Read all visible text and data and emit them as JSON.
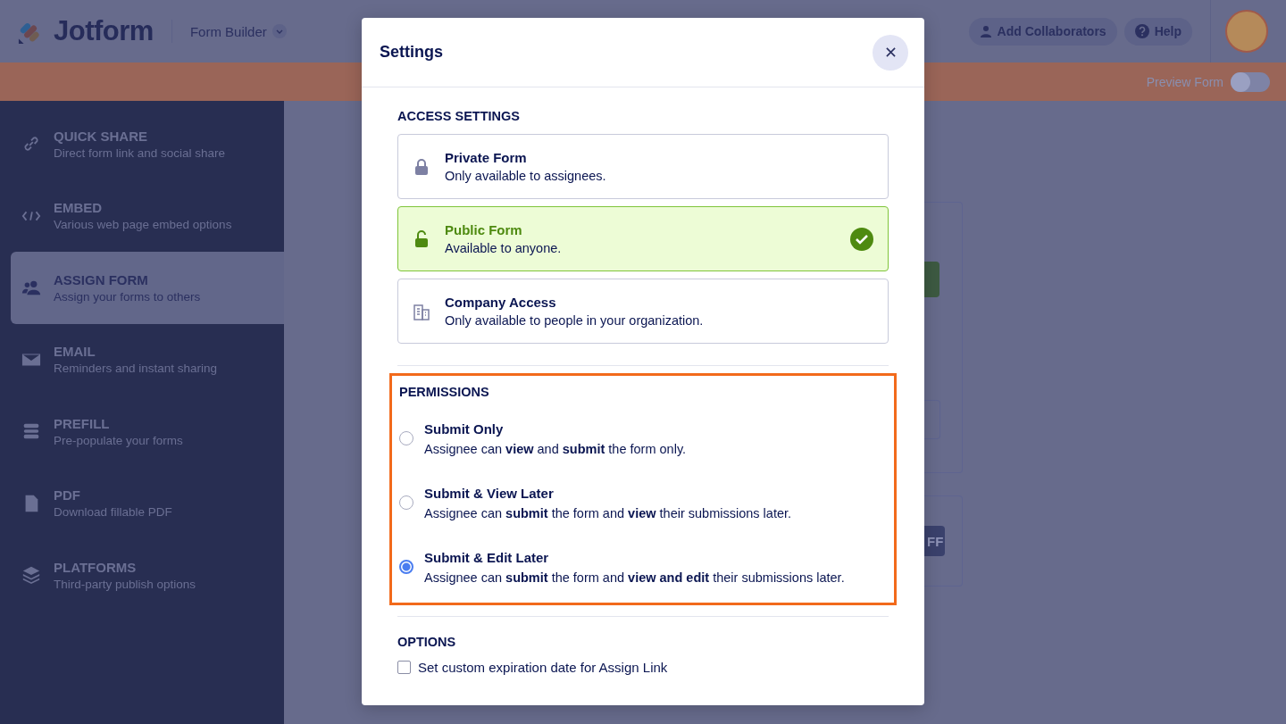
{
  "header": {
    "logo": "Jotform",
    "app_menu": "Form Builder",
    "buttons": [
      {
        "kind": "collaborators",
        "label": "Add Collaborators"
      },
      {
        "kind": "help",
        "label": "Help"
      }
    ]
  },
  "preview": {
    "label": "Preview Form",
    "on": false
  },
  "sidebar": {
    "items": [
      {
        "kind": "link",
        "title": "QUICK SHARE",
        "subtitle": "Direct form link and social share",
        "selected": false
      },
      {
        "kind": "code",
        "title": "EMBED",
        "subtitle": "Various web page embed options",
        "selected": false
      },
      {
        "kind": "people",
        "title": "ASSIGN FORM",
        "subtitle": "Assign your forms to others",
        "selected": true
      },
      {
        "kind": "mail",
        "title": "EMAIL",
        "subtitle": "Reminders and instant sharing",
        "selected": false
      },
      {
        "kind": "prefill",
        "title": "PREFILL",
        "subtitle": "Pre-populate your forms",
        "selected": false
      },
      {
        "kind": "pdf",
        "title": "PDF",
        "subtitle": "Download fillable PDF",
        "selected": false
      },
      {
        "kind": "layers",
        "title": "PLATFORMS",
        "subtitle": "Third-party publish options",
        "selected": false
      }
    ]
  },
  "background": {
    "button_fragment": "FF"
  },
  "modal": {
    "title": "Settings",
    "access": {
      "heading": "ACCESS SETTINGS",
      "options": [
        {
          "kind": "lock",
          "title": "Private Form",
          "description": "Only available to assignees.",
          "selected": false
        },
        {
          "kind": "unlock",
          "title": "Public Form",
          "description": "Available to anyone.",
          "selected": true
        },
        {
          "kind": "building",
          "title": "Company Access",
          "description": "Only available to people in your organization.",
          "selected": false
        }
      ]
    },
    "permissions": {
      "heading": "PERMISSIONS",
      "highlighted": true,
      "options": [
        {
          "title": "Submit Only",
          "description": "Assignee can **view** and **submit** the form only.",
          "selected": false
        },
        {
          "title": "Submit & View Later",
          "description": "Assignee can **submit** the form and **view** their submissions later.",
          "selected": false
        },
        {
          "title": "Submit & Edit Later",
          "description": "Assignee can **submit** the form and **view and edit** their submissions later.",
          "selected": true
        }
      ]
    },
    "options": {
      "heading": "OPTIONS",
      "checkbox": {
        "label": "Set custom expiration date for Assign Link",
        "checked": false
      }
    }
  }
}
